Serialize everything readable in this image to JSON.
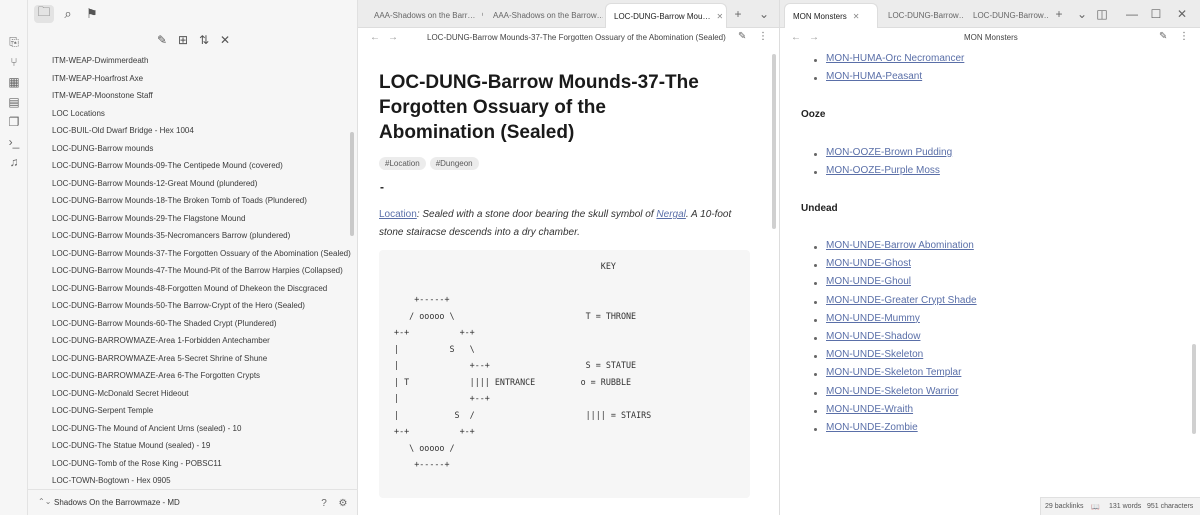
{
  "sidebar": {
    "files": [
      "ITM-WEAP-Dwimmerdeath",
      "ITM-WEAP-Hoarfrost Axe",
      "ITM-WEAP-Moonstone Staff",
      "LOC Locations",
      "LOC-BUIL-Old Dwarf Bridge - Hex 1004",
      "LOC-DUNG-Barrow mounds",
      "LOC-DUNG-Barrow Mounds-09-The Centipede Mound (covered)",
      "LOC-DUNG-Barrow Mounds-12-Great Mound (plundered)",
      "LOC-DUNG-Barrow Mounds-18-The Broken Tomb of Toads (Plundered)",
      "LOC-DUNG-Barrow Mounds-29-The Flagstone Mound",
      "LOC-DUNG-Barrow Mounds-35-Necromancers Barrow (plundered)",
      "LOC-DUNG-Barrow Mounds-37-The Forgotten Ossuary of the Abomination (Sealed)",
      "LOC-DUNG-Barrow Mounds-47-The Mound-Pit of the Barrow Harpies (Collapsed)",
      "LOC-DUNG-Barrow Mounds-48-Forgotten Mound of Dhekeon the Discgraced",
      "LOC-DUNG-Barrow Mounds-50-The Barrow-Crypt of the Hero (Sealed)",
      "LOC-DUNG-Barrow Mounds-60-The Shaded Crypt (Plundered)",
      "LOC-DUNG-BARROWMAZE-Area 1-Forbidden Antechamber",
      "LOC-DUNG-BARROWMAZE-Area 5-Secret Shrine of Shune",
      "LOC-DUNG-BARROWMAZE-Area 6-The Forgotten Crypts",
      "LOC-DUNG-McDonald Secret Hideout",
      "LOC-DUNG-Serpent Temple",
      "LOC-DUNG-The Mound of Ancient Urns (sealed) - 10",
      "LOC-DUNG-The Statue Mound (sealed) - 19",
      "LOC-DUNG-Tomb of the Rose King - POBSC11",
      "LOC-TOWN-Bogtown - Hex 0905"
    ],
    "vault_name": "Shadows On the Barrowmaze - MD"
  },
  "center": {
    "tabs": [
      "AAA-Shadows on the Barr…",
      "AAA-Shadows on the Barrow…",
      "LOC-DUNG-Barrow Mou…"
    ],
    "header_title": "LOC-DUNG-Barrow Mounds-37-The Forgotten Ossuary of the Abomination (Sealed)",
    "title": "LOC-DUNG-Barrow Mounds-37-The Forgotten Ossuary of the Abomination (Sealed)",
    "tags": [
      "#Location",
      "#Dungeon"
    ],
    "dash": "-",
    "para_link1": "Location",
    "para_text1": ": Sealed with a stone door bearing the skull symbol of ",
    "para_link2": "Nergal",
    "para_text2": ". A 10-foot stone stairacse descends into a dry chamber.",
    "code": "                                          KEY\n\n     +-----+\n    / ooooo \\                          T = THRONE\n +-+          +-+\n |          S   \\\n |              +--+                   S = STATUE\n | T            |||| ENTRANCE         o = RUBBLE\n |              +--+\n |           S  /                      |||| = STAIRS\n +-+          +-+\n    \\ ooooo /\n     +-----+"
  },
  "right": {
    "tabs": [
      "MON Monsters",
      "LOC-DUNG-Barrow…",
      "LOC-DUNG-Barrow…"
    ],
    "header_title": "MON Monsters",
    "list_top": [
      "MON-HUMA-Orc Necromancer",
      "MON-HUMA-Peasant"
    ],
    "heading_ooze": "Ooze",
    "list_ooze": [
      "MON-OOZE-Brown Pudding",
      "MON-OOZE-Purple Moss"
    ],
    "heading_undead": "Undead",
    "list_undead": [
      "MON-UNDE-Barrow Abomination",
      "MON-UNDE-Ghost",
      "MON-UNDE-Ghoul",
      "MON-UNDE-Greater Crypt Shade",
      "MON-UNDE-Mummy",
      "MON-UNDE-Shadow",
      "MON-UNDE-Skeleton",
      "MON-UNDE-Skeleton Templar",
      "MON-UNDE-Skeleton Warrior",
      "MON-UNDE-Wraith",
      "MON-UNDE-Zombie"
    ]
  },
  "status": {
    "backlinks": "29 backlinks",
    "words": "131 words",
    "chars": "951 characters"
  }
}
